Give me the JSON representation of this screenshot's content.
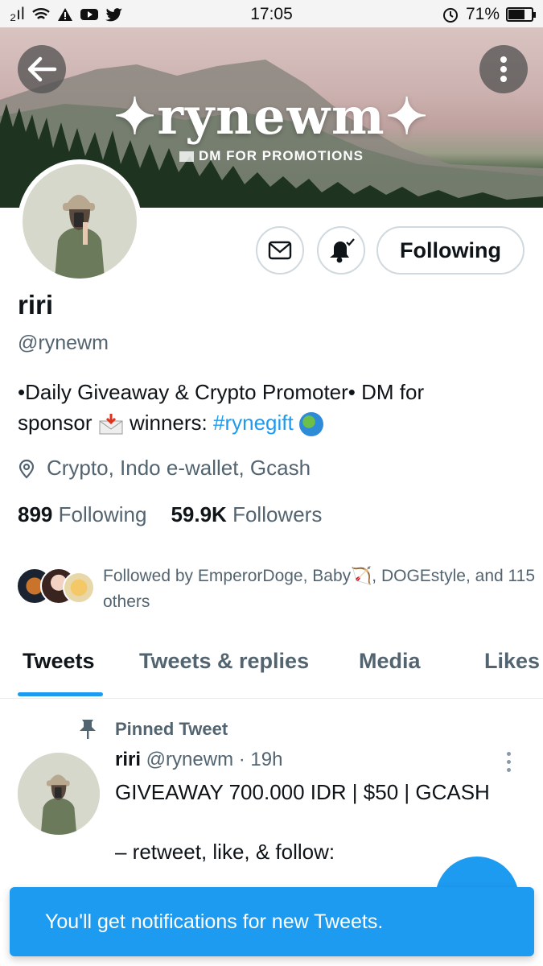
{
  "status_bar": {
    "signal": "₂ıl",
    "time": "17:05",
    "battery_percent": "71%"
  },
  "banner": {
    "title": "✦rynewm✦",
    "subtitle": "DM FOR PROMOTIONS"
  },
  "profile": {
    "name": "riri",
    "handle": "@rynewm",
    "bio_line1": "•Daily Giveaway & Crypto Promoter• DM for",
    "bio_line2_a": "sponsor ",
    "bio_line2_b": " winners: ",
    "bio_hashtag": "#rynegift",
    "location": "Crypto, Indo e-wallet, Gcash",
    "following_count": "899",
    "following_label": "Following",
    "followers_count": "59.9K",
    "followers_label": "Followers",
    "followed_by": "Followed by EmperorDoge, Baby🏹, DOGEstyle, and 115 others"
  },
  "actions": {
    "following_button": "Following"
  },
  "tabs": [
    "Tweets",
    "Tweets & replies",
    "Media",
    "Likes"
  ],
  "pinned_tweet": {
    "label": "Pinned Tweet",
    "name": "riri",
    "meta": " @rynewm · 19h",
    "text": "GIVEAWAY 700.000 IDR | $50 | GCASH\n\n– retweet, like, & follow:"
  },
  "toast": {
    "message": "You'll get notifications for new Tweets."
  },
  "colors": {
    "accent": "#1d9bf0",
    "secondary_text": "#536471"
  }
}
